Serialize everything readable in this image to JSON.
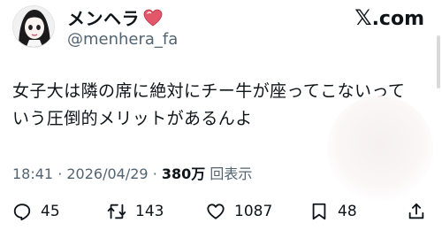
{
  "author": {
    "display_name": "メンヘラ",
    "handle": "@menhera_fa",
    "verified_heart_icon": "heart-icon",
    "heart_color": "#e2586a"
  },
  "brand": {
    "logo_letter": "𝕏",
    "logo_text": ".com"
  },
  "tweet": {
    "text": "女子大は隣の席に絶対にチー牛が座ってこないって\nいう圧倒的メリットがあるんよ",
    "time": "18:41",
    "date": "2026/04/29",
    "views_count": "380万",
    "views_label": "回表示"
  },
  "actions": {
    "reply_count": "45",
    "repost_count": "143",
    "like_count": "1087",
    "bookmark_count": "48",
    "icons": [
      "reply-icon",
      "repost-icon",
      "like-icon",
      "bookmark-icon",
      "share-icon"
    ]
  }
}
